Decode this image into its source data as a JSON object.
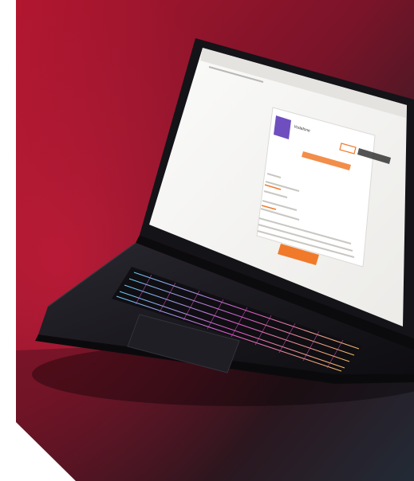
{
  "photo": {
    "subject": "laptop-on-red-backdrop",
    "colors": {
      "backdrop_red": "#a3132d",
      "backdrop_dark": "#26191f",
      "backdrop_teal": "#1e3b47",
      "page_bg": "#ffffff",
      "laptop_body": "#1b1a1f",
      "screen_white": "#f6f6f4",
      "accent_orange": "#f07a2a",
      "accent_purple": "#6f4fbf",
      "keyboard_glow_cyan": "#6fd3ff",
      "keyboard_glow_magenta": "#e45bd1",
      "keyboard_glow_amber": "#ffc46a"
    }
  },
  "screen": {
    "logo_text": "Vodafone"
  }
}
